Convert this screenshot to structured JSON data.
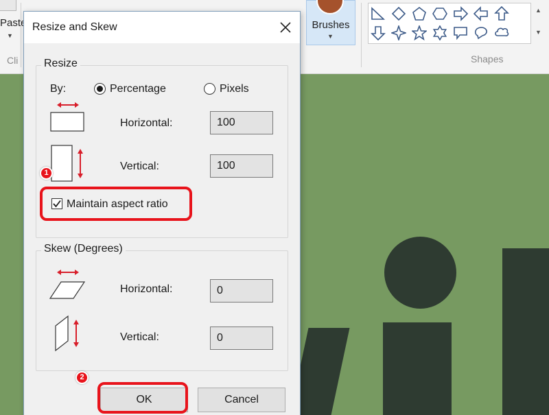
{
  "ribbon": {
    "paste_label": "Paste",
    "clipboard_label": "Cli",
    "brushes_label": "Brushes",
    "shapes_label": "Shapes",
    "shape_icons": [
      "triangle-icon",
      "diamond-icon",
      "pentagon-icon",
      "hexagon-icon",
      "right-arrow-icon",
      "left-arrow-icon",
      "up-arrow-icon",
      "down-arrow-icon",
      "four-point-star-icon",
      "five-point-star-icon",
      "six-point-star-icon",
      "rect-callout-icon",
      "oval-callout-icon",
      "cloud-callout-icon"
    ]
  },
  "dialog": {
    "title": "Resize and Skew",
    "resize": {
      "legend": "Resize",
      "by_label": "By:",
      "percentage_label": "Percentage",
      "pixels_label": "Pixels",
      "selected_mode": "Percentage",
      "horizontal_label": "Horizontal:",
      "horizontal_value": "100",
      "vertical_label": "Vertical:",
      "vertical_value": "100",
      "maintain_aspect_label": "Maintain aspect ratio",
      "maintain_aspect_checked": true
    },
    "skew": {
      "legend": "Skew (Degrees)",
      "horizontal_label": "Horizontal:",
      "horizontal_value": "0",
      "vertical_label": "Vertical:",
      "vertical_value": "0"
    },
    "ok_label": "OK",
    "cancel_label": "Cancel"
  },
  "annotations": {
    "step1": "1",
    "step2": "2",
    "highlight_color": "#e8131b"
  },
  "colors": {
    "canvas": "#779a61",
    "art": "#2e3b31",
    "arrow_accent": "#d81e2a"
  }
}
